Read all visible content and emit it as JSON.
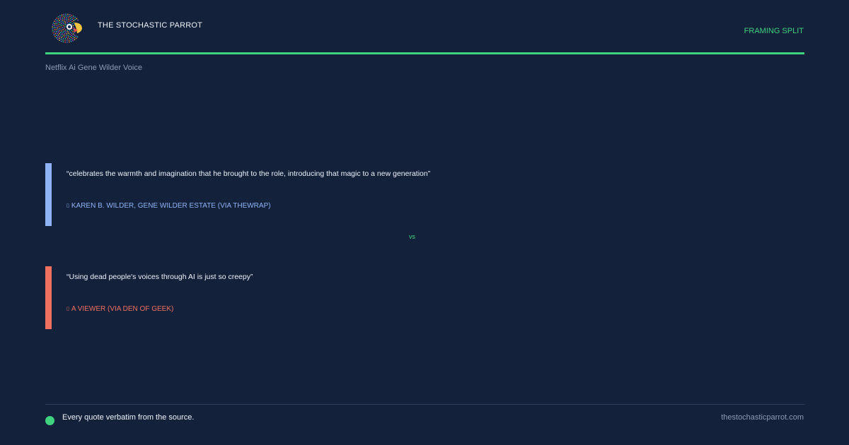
{
  "header": {
    "brand_name": "THE STOCHASTIC PARROT",
    "tag": "FRAMING SPLIT",
    "logo_icon": "parrot-logo-icon"
  },
  "topic": "Netflix Ai Gene Wilder Voice",
  "quotes": [
    {
      "text": "“celebrates the warmth and imagination that he brought to the role, introducing that magic to a new generation”",
      "attribution": "KAREN B. WILDER, GENE WILDER ESTATE (VIA THEWRAP)",
      "attribution_icon": "attribution-glyph-icon",
      "accent_color": "#8fb4f5"
    },
    {
      "text": "“Using dead people's voices through AI is just so creepy”",
      "attribution": "A VIEWER (VIA DEN OF GEEK)",
      "attribution_icon": "attribution-glyph-icon",
      "accent_color": "#f0705f"
    }
  ],
  "vs_label": "vs",
  "footer": {
    "note": "Every quote verbatim from the source.",
    "site": "thestochasticparrot.com"
  },
  "colors": {
    "background": "#13213b",
    "accent_green": "#3fd37f",
    "muted": "#8c9ab3",
    "text": "#eef2f8"
  }
}
